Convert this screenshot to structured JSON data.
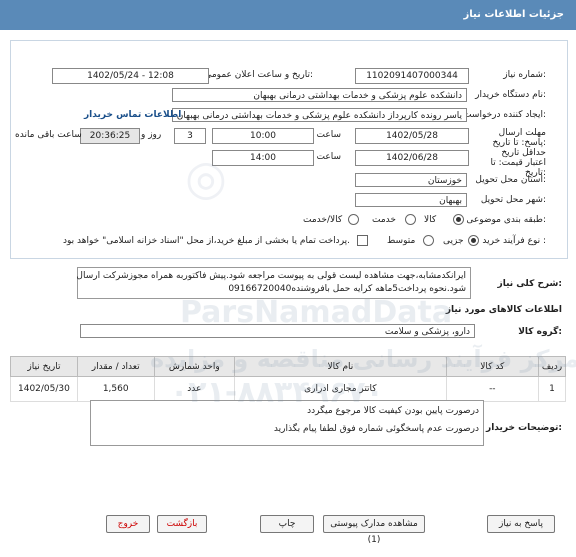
{
  "header": {
    "title": "جزئیات اطلاعات نیاز"
  },
  "form": {
    "need_number_label": "شماره نیاز:",
    "need_number": "1102091407000344",
    "announce_label": "تاریخ و ساعت اعلان عمومی:",
    "announce_value": "1402/05/24 - 12:08",
    "buyer_org_label": "نام دستگاه خریدار:",
    "buyer_org": "دانشکده علوم پزشکی و خدمات بهداشتی  درمانی بهبهان",
    "creator_label": "ایجاد کننده درخواست:",
    "creator": "یاسر رونده کارپرداز دانشکده علوم پزشکی و خدمات بهداشتی  درمانی بهبهان",
    "contact_link": "اطلاعات تماس خریدار",
    "deadline_label": "مهلت ارسال پاسخ: تا تاریخ:",
    "deadline_date": "1402/05/28",
    "time_label": "ساعت",
    "deadline_time": "10:00",
    "days": "3",
    "day_and": "روز و",
    "remaining_time": "20:36:25",
    "remaining_label": "ساعت باقی مانده",
    "validity_label": "حداقل تاریخ اعتبار قیمت: تا تاریخ:",
    "validity_date": "1402/06/28",
    "validity_time_label": "ساعت",
    "validity_time": "14:00",
    "province_label": "استان محل تحویل:",
    "province": "خوزستان",
    "city_label": "شهر محل تحویل:",
    "city": "بهبهان",
    "category_label": "طبقه بندی موضوعی:",
    "category_options": [
      "کالا",
      "خدمت",
      "کالا/خدمت"
    ],
    "process_label": "نوع فرآیند خرید :",
    "process_options": [
      "جزیی",
      "متوسط"
    ],
    "payment_note": "پرداخت تمام یا بخشی از مبلغ خرید،از محل \"اسناد خزانه اسلامی\" خواهد بود."
  },
  "description": {
    "label": "شرح کلی نیاز:",
    "text_line1": "ایرانکدمشابه،جهت مشاهده لیست قولی به پیوست مراجعه شود.پیش فاکتوربه همراه مجوزشرکت ارسال",
    "text_line2": "شود.نحوه پرداخت5ماهه کرایه حمل بافروشنده09166720040"
  },
  "goods": {
    "section_title": "اطلاعات کالاهای مورد نیاز",
    "group_label": "گروه کالا:",
    "group_value": "دارو، پزشکی و سلامت",
    "columns": [
      "ردیف",
      "کد کالا",
      "نام کالا",
      "واحد شمارش",
      "تعداد / مقدار",
      "تاریخ نیاز"
    ],
    "rows": [
      {
        "row": "1",
        "code": "--",
        "name": "کاتتر مجاری ادراری",
        "unit": "عدد",
        "qty": "1,560",
        "date": "1402/05/30"
      }
    ]
  },
  "buyer_notes": {
    "label": "توضیحات خریدار:",
    "line1": "درصورت پایین بودن کیفیت کالا مرجوع میگردد",
    "line2": "درصورت عدم پاسخگوئی شماره فوق لطفا پیام بگذارید"
  },
  "buttons": {
    "reply": "پاسخ به نیاز",
    "attachments": "مشاهده مدارک پیوستی (1)",
    "print": "چاپ",
    "back": "بازگشت",
    "exit": "خروج"
  },
  "watermark": {
    "brand": "ParsNamadData",
    "tagline": "مرکز فرآیند رسانی مناقصه و مزایده",
    "phone": "۰۲۱-۸۸۳۴۹۶۷۰"
  }
}
